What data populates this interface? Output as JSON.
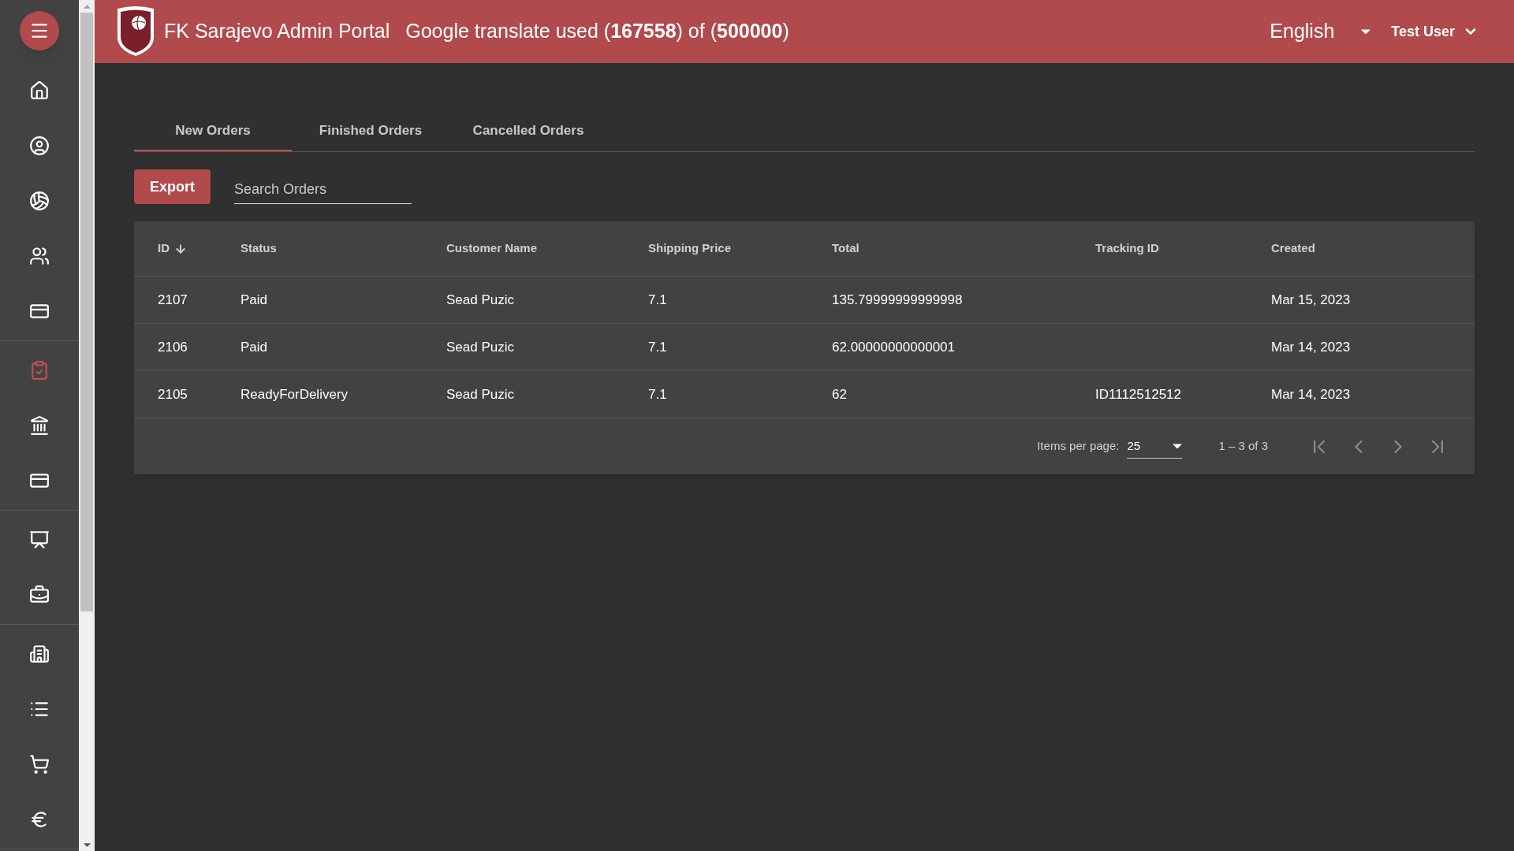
{
  "sidebar": {
    "groups": [
      {
        "items": [
          {
            "selected": false
          },
          {
            "selected": false
          },
          {
            "selected": false
          },
          {
            "selected": false
          },
          {
            "selected": false
          }
        ]
      },
      {
        "items": [
          {
            "selected": true
          },
          {
            "selected": false
          },
          {
            "selected": false
          }
        ]
      },
      {
        "items": [
          {
            "selected": false
          },
          {
            "selected": false
          }
        ]
      },
      {
        "items": [
          {
            "selected": false
          },
          {
            "selected": false
          },
          {
            "selected": false
          },
          {
            "selected": false
          }
        ]
      }
    ]
  },
  "header": {
    "title": "FK Sarajevo Admin Portal",
    "usage": "Google translate used (**167558**) of (**500000**)",
    "language": "English",
    "user": "Test User"
  },
  "tabs": [
    {
      "label": "New Orders",
      "selected": true
    },
    {
      "label": "Finished Orders",
      "selected": false
    },
    {
      "label": "Cancelled Orders",
      "selected": false
    }
  ],
  "toolbar": {
    "export": "Export",
    "search": {
      "placeholder": "Search Orders"
    }
  },
  "table": {
    "columns": [
      {
        "label": "ID",
        "sorted": true
      },
      {
        "label": "Status",
        "sorted": false
      },
      {
        "label": "Customer Name",
        "sorted": false
      },
      {
        "label": "Shipping Price",
        "sorted": false
      },
      {
        "label": "Total",
        "sorted": false
      },
      {
        "label": "Tracking ID",
        "sorted": false
      },
      {
        "label": "Created",
        "sorted": false
      }
    ],
    "rows": [
      [
        "2107",
        "Paid",
        "Sead Puzic",
        "7.1",
        "135.79999999999998",
        "",
        "Mar 15, 2023"
      ],
      [
        "2106",
        "Paid",
        "Sead Puzic",
        "7.1",
        "62.00000000000001",
        "",
        "Mar 14, 2023"
      ],
      [
        "2105",
        "ReadyForDelivery",
        "Sead Puzic",
        "7.1",
        "62",
        "ID1112512512",
        "Mar 14, 2023"
      ]
    ]
  },
  "paginator": {
    "label": "Items per page:",
    "page_size": "25",
    "range": "1 – 3 of 3"
  }
}
